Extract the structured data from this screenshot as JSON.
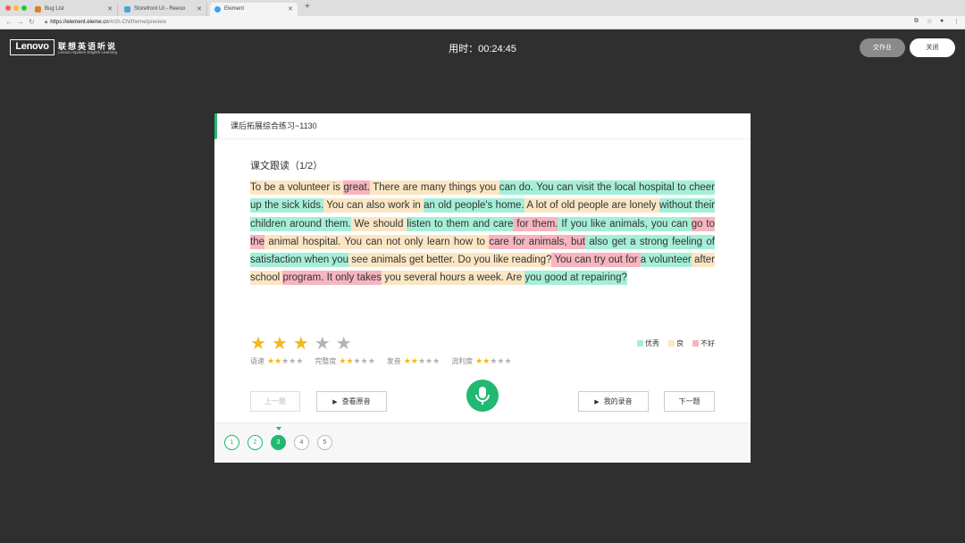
{
  "browser": {
    "tabs": [
      {
        "label": "Bug List",
        "icon_color": "#d9822b"
      },
      {
        "label": "Storefront UI - Reeoo",
        "icon_color": "#4aa3df"
      },
      {
        "label": "Element",
        "icon_color": "#409eff"
      }
    ],
    "url_host": "https://element.eleme.cn",
    "url_path": "/#/zh-CN/theme/preview"
  },
  "header": {
    "logo": "Lenovo",
    "brand_cn": "联想英语听说",
    "brand_en": "Lenovo Spoken English Learning",
    "timer": "用时：00:24:45",
    "submit_label": "交作业",
    "close_label": "关闭"
  },
  "card": {
    "title": "课后拓展综合练习~1130",
    "section": "课文跟读（1/2）",
    "passage": [
      {
        "t": "To be a volunteer is ",
        "c": "good"
      },
      {
        "t": "great.",
        "c": "bad"
      },
      {
        "t": " There are many things you ",
        "c": "good"
      },
      {
        "t": "can do. You can visit the local hospital to cheer up the sick kids.",
        "c": "excellent"
      },
      {
        "t": " You can also work in ",
        "c": "good"
      },
      {
        "t": "an old people's home.",
        "c": "excellent"
      },
      {
        "t": " A lot of old people are lonely ",
        "c": "good"
      },
      {
        "t": "without their children around them.",
        "c": "excellent"
      },
      {
        "t": " We should ",
        "c": "good"
      },
      {
        "t": "listen to them and care",
        "c": "excellent"
      },
      {
        "t": " for them.",
        "c": "bad"
      },
      {
        "t": " If you like animals, you can ",
        "c": "excellent"
      },
      {
        "t": "go to the",
        "c": "bad"
      },
      {
        "t": " animal hospital. You can not only learn how to ",
        "c": "good"
      },
      {
        "t": "care for animals, but",
        "c": "bad"
      },
      {
        "t": " also get a strong feeling of satisfaction when you",
        "c": "excellent"
      },
      {
        "t": " see animals get better. Do you like reading?",
        "c": "good"
      },
      {
        "t": " You can try out for ",
        "c": "bad"
      },
      {
        "t": "a volunteer",
        "c": "excellent"
      },
      {
        "t": " after school ",
        "c": "good"
      },
      {
        "t": "program. It only takes",
        "c": "bad"
      },
      {
        "t": " you several hours a week. Are ",
        "c": "good"
      },
      {
        "t": "you good at repairing?",
        "c": "excellent"
      }
    ],
    "overall_rating": 3,
    "rating_max": 5,
    "legend": [
      {
        "label": "优秀",
        "color": "#a5efd8"
      },
      {
        "label": "良",
        "color": "#fbe6c4"
      },
      {
        "label": "不好",
        "color": "#f7b5c0"
      }
    ],
    "metrics": [
      {
        "label": "语速",
        "rating": 2
      },
      {
        "label": "完整度",
        "rating": 2
      },
      {
        "label": "发音",
        "rating": 2
      },
      {
        "label": "流利度",
        "rating": 2
      }
    ],
    "buttons": {
      "prev": "上一题",
      "original": "查看原音",
      "mine": "我的录音",
      "next": "下一题"
    },
    "pages": [
      {
        "n": "1",
        "state": "done"
      },
      {
        "n": "2",
        "state": "done"
      },
      {
        "n": "3",
        "state": "current"
      },
      {
        "n": "4",
        "state": "todo"
      },
      {
        "n": "5",
        "state": "todo"
      }
    ]
  },
  "colors": {
    "accent": "#21b870",
    "star": "#f4b71c",
    "background": "#2f2f2f"
  }
}
